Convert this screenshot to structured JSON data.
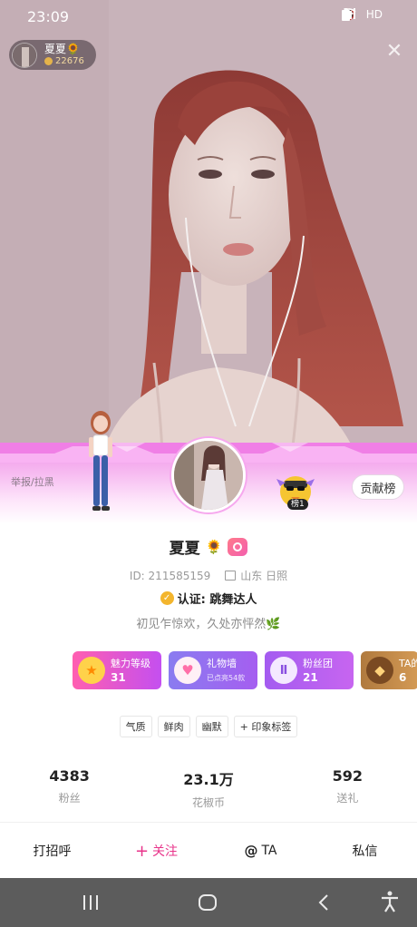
{
  "status_bar": {
    "time": "23:09",
    "network": "HD",
    "signal": "4G"
  },
  "host_chip": {
    "name": "夏夏🌻",
    "coins": "22676"
  },
  "close_icon": "close-icon",
  "card": {
    "report_label": "举报/拉黑",
    "rank_label": "贡献榜",
    "top_fan_badge": "榜1"
  },
  "profile": {
    "name": "夏夏",
    "name_emoji": "🌻",
    "id_text": "ID: 211585159",
    "location": "山东 日照",
    "verify_text": "认证: 跳舞达人",
    "bio": "初见乍惊欢，久处亦怦然🌿"
  },
  "features": [
    {
      "title": "魅力等级",
      "value": "31",
      "icon": "star-icon",
      "color_from": "#ff5fb0",
      "color_to": "#c44ff0"
    },
    {
      "title": "礼物墙",
      "sub": "已点亮54款",
      "icon": "heart-icon",
      "color_from": "#8a7cf0",
      "color_to": "#a55ef0"
    },
    {
      "title": "粉丝团",
      "value": "21",
      "icon": "wings-icon",
      "color_from": "#a45cf0",
      "color_to": "#c765f0"
    },
    {
      "title": "TA的",
      "value": "6",
      "icon": "gem-icon",
      "color_from": "#b07a3e",
      "color_to": "#d49a55"
    }
  ],
  "tags": [
    "气质",
    "鲜肉",
    "幽默",
    "+ 印象标签"
  ],
  "stats": [
    {
      "value": "4383",
      "label": "粉丝"
    },
    {
      "value": "23.1万",
      "label": "花椒币"
    },
    {
      "value": "592",
      "label": "送礼"
    }
  ],
  "actions": {
    "greet": "打招呼",
    "follow": "关注",
    "mention": "TA",
    "message": "私信"
  },
  "colors": {
    "accent_pink": "#e8338a",
    "band_pink": "#f08ee8",
    "nav_bg": "#5c5c5c"
  }
}
